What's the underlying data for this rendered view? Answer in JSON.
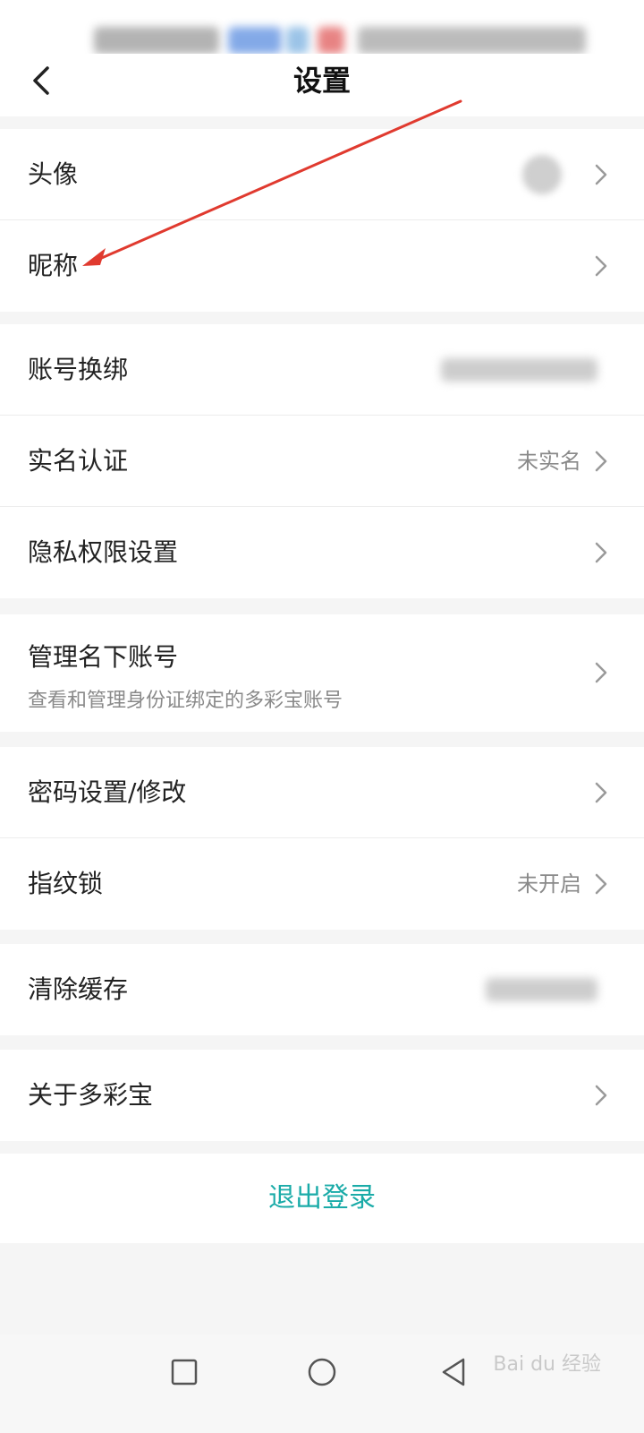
{
  "header": {
    "title": "设置"
  },
  "groups": [
    {
      "rows": [
        {
          "label": "头像"
        },
        {
          "label": "昵称"
        }
      ]
    },
    {
      "rows": [
        {
          "label": "账号换绑"
        },
        {
          "label": "实名认证",
          "value": "未实名"
        },
        {
          "label": "隐私权限设置"
        }
      ]
    },
    {
      "rows": [
        {
          "label": "管理名下账号",
          "subtitle": "查看和管理身份证绑定的多彩宝账号"
        }
      ]
    },
    {
      "rows": [
        {
          "label": "密码设置/修改"
        },
        {
          "label": "指纹锁",
          "value": "未开启"
        }
      ]
    },
    {
      "rows": [
        {
          "label": "清除缓存"
        }
      ]
    },
    {
      "rows": [
        {
          "label": "关于多彩宝"
        }
      ]
    }
  ],
  "logout": {
    "label": "退出登录"
  },
  "colors": {
    "accent": "#1aaba8",
    "annotation_arrow": "#e03a2f"
  },
  "icons": {
    "back": "chevron-left-icon",
    "row_arrow": "chevron-right-icon"
  }
}
